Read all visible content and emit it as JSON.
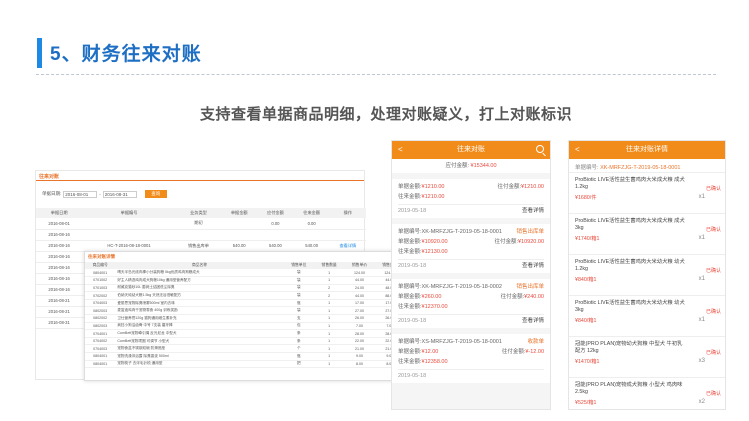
{
  "page": {
    "title": "5、财务往来对账",
    "subtitle": "支持查看单据商品明细，处理对账疑义，打上对账标识"
  },
  "desktop": {
    "panel_title": "往来对账",
    "filter_label": "单据日期:",
    "date_from": "2016-08-01",
    "date_to": "2016-08-31",
    "query_label": "查询",
    "columns": [
      "单据日期",
      "单据编号",
      "业务类型",
      "单据金额",
      "应付金额",
      "往来金额",
      "操作"
    ],
    "rows": [
      {
        "date": "2016-08-01",
        "no": "",
        "type": "期初",
        "amt": "",
        "pay": "0.00",
        "bal": "0.00",
        "op": ""
      },
      {
        "date": "2016-08-16",
        "no": "",
        "type": "",
        "amt": "",
        "pay": "",
        "bal": "",
        "op": ""
      },
      {
        "date": "2016-08-16",
        "no": "HC-T-2016-08-18-0001",
        "type": "销售出库单",
        "amt": "540.00",
        "pay": "540.00",
        "bal": "540.00",
        "op": "查看详情"
      },
      {
        "date": "2016-08-16",
        "no": "",
        "type": "",
        "amt": "",
        "pay": "",
        "bal": "",
        "op": ""
      },
      {
        "date": "2016-08-16",
        "no": "",
        "type": "",
        "amt": "",
        "pay": "",
        "bal": "",
        "op": ""
      },
      {
        "date": "2016-08-16",
        "no": "",
        "type": "",
        "amt": "",
        "pay": "",
        "bal": "",
        "op": ""
      },
      {
        "date": "2016-08-16",
        "no": "",
        "type": "",
        "amt": "",
        "pay": "",
        "bal": "",
        "op": ""
      },
      {
        "date": "2016-08-21",
        "no": "",
        "type": "",
        "amt": "",
        "pay": "",
        "bal": "",
        "op": ""
      },
      {
        "date": "2016-08-21",
        "no": "",
        "type": "",
        "amt": "",
        "pay": "",
        "bal": "",
        "op": ""
      },
      {
        "date": "2016-08-31",
        "no": "",
        "type": "",
        "amt": "",
        "pay": "",
        "bal": "",
        "op": ""
      }
    ],
    "detail_title": "往来对账详情",
    "detail_columns": [
      "商品编号",
      "商品名称",
      "销售单位",
      "销售数量",
      "销售单价",
      "销售金额"
    ],
    "detail_rows": [
      {
        "code": "0804001",
        "name": "晴天半岛光线肉棒小分装狗粮 5kg优质鸡肉狗粮成犬",
        "unit": "袋",
        "qty": "1",
        "price": "124.00",
        "amt": "124.00"
      },
      {
        "code": "0701002",
        "name": "好主人精选鸡肉成犬狗粮10kg 通用型营养配方",
        "unit": "袋",
        "qty": "1",
        "price": "44.00",
        "amt": "44.00"
      },
      {
        "code": "0701003",
        "name": "耐威克猫砂10L 膨润土结团低尘除臭",
        "unit": "袋",
        "qty": "2",
        "price": "24.00",
        "amt": "48.00"
      },
      {
        "code": "0702002",
        "name": "伯纳天纯幼犬粮1.5kg 天然无谷低敏配方",
        "unit": "袋",
        "qty": "2",
        "price": "44.00",
        "amt": "88.00"
      },
      {
        "code": "0704003",
        "name": "爱丽思宠物除臭喷雾500ml 室内去味",
        "unit": "瓶",
        "qty": "1",
        "price": "17.00",
        "amt": "17.00"
      },
      {
        "code": "0802003",
        "name": "麦富迪鸡肉干宠物零食 400g 训练奖励",
        "unit": "袋",
        "qty": "1",
        "price": "27.00",
        "amt": "27.00"
      },
      {
        "code": "0802002",
        "name": "卫仕营养膏120g 猫狗通用维生素补充",
        "unit": "支",
        "qty": "1",
        "price": "26.00",
        "amt": "26.00"
      },
      {
        "code": "0802003",
        "name": "疯狂小狗洁齿骨 中号 7支装 磨牙棒",
        "unit": "包",
        "qty": "1",
        "price": "7.00",
        "amt": "7.00"
      },
      {
        "code": "0704001",
        "name": "ComBett宠物牵引绳 反光尼龙 中型犬",
        "unit": "条",
        "qty": "1",
        "price": "28.00",
        "amt": "28.00"
      },
      {
        "code": "0704002",
        "name": "ComBett宠物项圈 可调节 小型犬",
        "unit": "条",
        "qty": "1",
        "price": "22.00",
        "amt": "22.00"
      },
      {
        "code": "0704003",
        "name": "宠物食盆不锈钢双碗 防滑底座",
        "unit": "个",
        "qty": "1",
        "price": "21.00",
        "amt": "21.00"
      },
      {
        "code": "0804001",
        "name": "宠物洗澡沐浴露 除臭香波 500ml",
        "unit": "瓶",
        "qty": "1",
        "price": "9.00",
        "amt": "9.00"
      },
      {
        "code": "0804001",
        "name": "宠物梳子 去浮毛针梳 通用型",
        "unit": "把",
        "qty": "1",
        "price": "8.00",
        "amt": "8.00"
      }
    ]
  },
  "mobile1": {
    "title": "往来对账",
    "back": "<",
    "total_label": "应付金额:",
    "total_value": "¥15344.00",
    "cards": [
      {
        "no": "",
        "no_label": "",
        "status": "",
        "amt_label": "单据金额:",
        "amt": "¥1210.00",
        "pay_label": "往付金额:",
        "pay": "¥1210.00",
        "bal_label": "往来金额:",
        "bal": "¥1210.00",
        "date": "2019-05-18",
        "detail": "查看详情"
      },
      {
        "no_label": "单据编号:",
        "no": "XK-MRFZJG-T-2019-05-18-0001",
        "status": "销售出库单",
        "amt_label": "单据金额:",
        "amt": "¥10920.00",
        "pay_label": "往付金额:",
        "pay": "¥10920.00",
        "bal_label": "往来金额:",
        "bal": "¥12130.00",
        "date": "2019-05-18",
        "detail": "查看详情"
      },
      {
        "no_label": "单据编号:",
        "no": "XK-MRFZJG-T-2019-05-18-0002",
        "status": "销售出库单",
        "amt_label": "单据金额:",
        "amt": "¥260.00",
        "pay_label": "往付金额:",
        "pay": "¥240.00",
        "bal_label": "往来金额:",
        "bal": "¥12370.00",
        "date": "2019-05-18",
        "detail": "查看详情"
      },
      {
        "no_label": "单据编号:",
        "no": "XS-MRFZJG-T-2019-05-18-0001",
        "status": "收款单",
        "amt_label": "单据金额:",
        "amt": "¥12.00",
        "pay_label": "往付金额:",
        "pay": "¥-12.00",
        "bal_label": "往来金额:",
        "bal": "¥12358.00",
        "date": "2019-05-18",
        "detail": ""
      }
    ]
  },
  "mobile2": {
    "title": "往来对账详情",
    "back": "<",
    "no_label": "单据编号:",
    "no": "XK-MRFZJG-T-2019-05-18-0001",
    "items": [
      {
        "name": "ProBiotic LIVE活性益生菌鸡肉大米成犬粮 成犬 1.2kg",
        "price": "¥1680/件",
        "qty": "x1",
        "status": "已确认"
      },
      {
        "name": "ProBiotic LIVE活性益生菌鸡肉大米成犬粮 成犬 3kg",
        "price": "¥1740/箱1",
        "qty": "x1",
        "status": "已确认"
      },
      {
        "name": "ProBiotic LIVE活性益生菌鸡肉大米幼犬粮 幼犬 1.2kg",
        "price": "¥840/箱1",
        "qty": "x1",
        "status": "已确认"
      },
      {
        "name": "ProBiotic LIVE活性益生菌鸡肉大米幼犬粮 幼犬 3kg",
        "price": "¥840/箱1",
        "qty": "x1",
        "status": "已确认"
      },
      {
        "name": "冠能(PRO PLAN)宠物幼犬狗粮 中型犬 牛初乳配方 12kg",
        "price": "¥1470/箱1",
        "qty": "x3",
        "status": "已确认"
      },
      {
        "name": "冠能(PRO PLAN)宠物成犬狗粮 小型犬 鸡肉味 2.5kg",
        "price": "¥525/箱1",
        "qty": "x2",
        "status": "已确认"
      }
    ]
  },
  "colors": {
    "brand_blue": "#1e6fc4",
    "orange": "#f18b1a",
    "red": "#e84a3c"
  }
}
